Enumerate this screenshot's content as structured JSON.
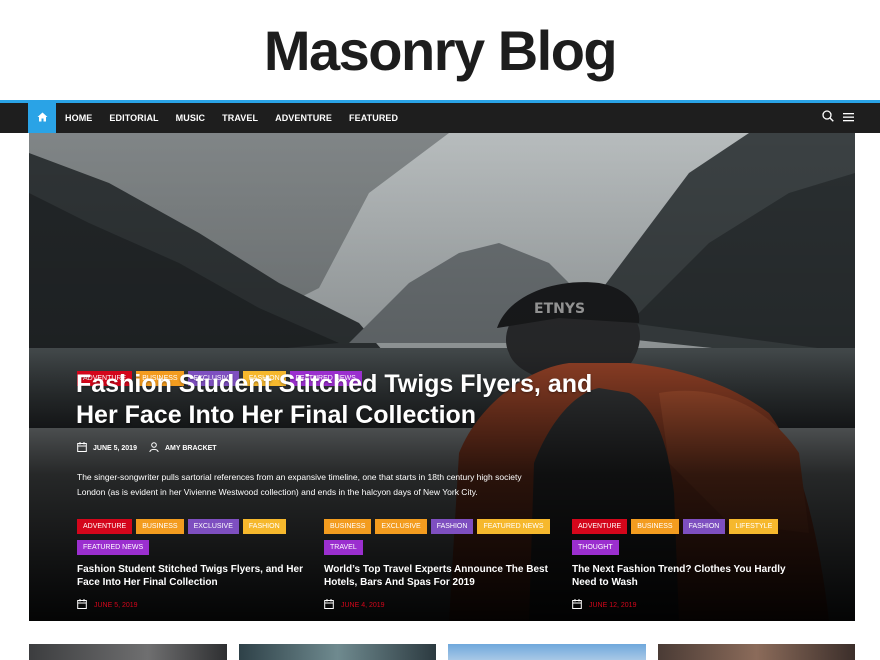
{
  "site": {
    "title": "Masonry Blog"
  },
  "nav": {
    "home_icon": "home-icon",
    "items": [
      {
        "label": "HOME"
      },
      {
        "label": "EDITORIAL"
      },
      {
        "label": "MUSIC"
      },
      {
        "label": "TRAVEL"
      },
      {
        "label": "ADVENTURE"
      },
      {
        "label": "FEATURED"
      }
    ],
    "tools": [
      "search-icon",
      "menu-icon"
    ]
  },
  "hero": {
    "categories": [
      "ADVENTURE",
      "BUSINESS",
      "EXCLUSIVE",
      "FASHION",
      "FEATURED NEWS"
    ],
    "title": "Fashion Student Stitched Twigs Flyers, and Her Face Into Her Final Collection",
    "date": "JUNE 5, 2019",
    "author": "AMY BRACKET",
    "excerpt": "The singer-songwriter pulls sartorial references from an expansive timeline, one that starts in 18th century high society London (as is evident in her Vivienne Westwood collection) and ends in the halcyon days of New York City."
  },
  "cards": [
    {
      "categories": [
        "ADVENTURE",
        "BUSINESS",
        "EXCLUSIVE",
        "FASHION",
        "FEATURED NEWS"
      ],
      "title": "Fashion Student Stitched Twigs Flyers, and Her Face Into Her Final Collection",
      "date": "JUNE 5, 2019"
    },
    {
      "categories": [
        "BUSINESS",
        "EXCLUSIVE",
        "FASHION",
        "FEATURED NEWS",
        "TRAVEL"
      ],
      "title": "World’s Top Travel Experts Announce The Best Hotels, Bars And Spas For 2019",
      "date": "JUNE 4, 2019"
    },
    {
      "categories": [
        "ADVENTURE",
        "BUSINESS",
        "FASHION",
        "LIFESTYLE",
        "THOUGHT"
      ],
      "title": "The Next Fashion Trend? Clothes You Hardly Need to Wash",
      "date": "JUNE 12, 2019"
    }
  ],
  "colors": {
    "accent": "#2aa3e6",
    "navbar": "#1e1e1e",
    "date_red": "#d4061b"
  }
}
